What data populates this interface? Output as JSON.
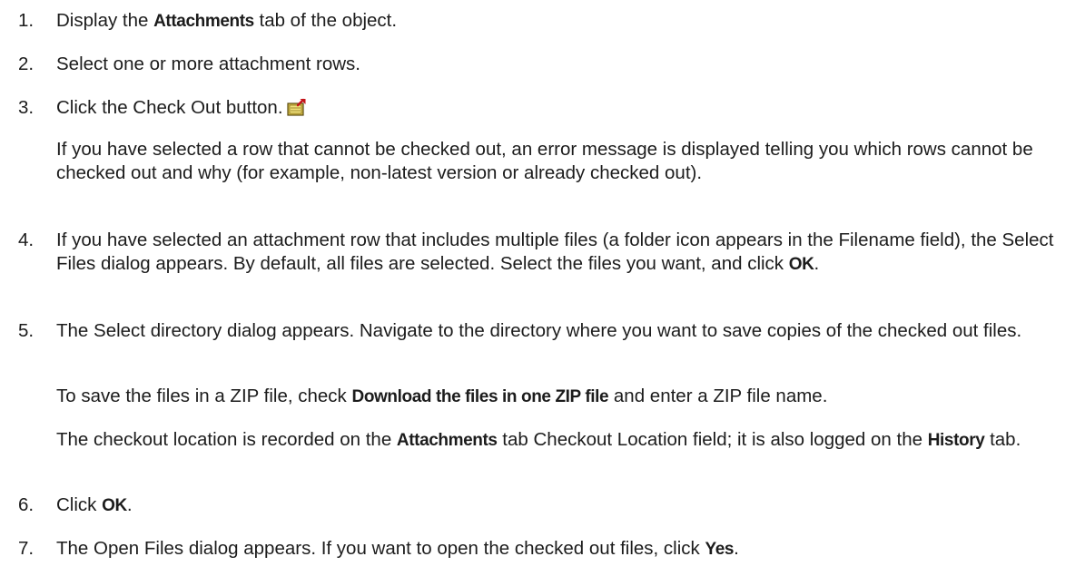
{
  "steps": [
    {
      "number": "1.",
      "before": "Display the ",
      "bold": "Attachments",
      "after": " tab of the object."
    },
    {
      "number": "2.",
      "text": "Select one or more attachment rows."
    },
    {
      "number": "3.",
      "text": "Click the Check Out button.",
      "icon": "check-out-icon",
      "note": "If you have selected a row that cannot be checked out, an error message is displayed telling you which rows cannot be checked out and why (for example, non-latest version or already checked out)."
    },
    {
      "number": "4.",
      "before": "If you have selected an attachment row that includes multiple files (a folder icon appears in the Filename field), the Select Files dialog appears. By default, all files are selected. Select the files you want, and click ",
      "bold": "OK",
      "after": "."
    },
    {
      "number": "5.",
      "text": "The Select directory dialog appears. Navigate to the directory where you want to save copies of the checked out files.",
      "zip_before": "To save the files in a ZIP file, check ",
      "zip_bold": "Download the files in one ZIP file",
      "zip_after": " and enter a ZIP file name.",
      "loc_before": "The checkout location is recorded on the ",
      "loc_bold1": "Attachments",
      "loc_mid": " tab Checkout Location field; it is also logged on the ",
      "loc_bold2": "History",
      "loc_after": " tab."
    },
    {
      "number": "6.",
      "before": "Click ",
      "bold": "OK",
      "after": "."
    },
    {
      "number": "7.",
      "before": "The Open Files dialog appears. If you want to open the checked out files, click ",
      "bold": "Yes",
      "after": "."
    }
  ]
}
